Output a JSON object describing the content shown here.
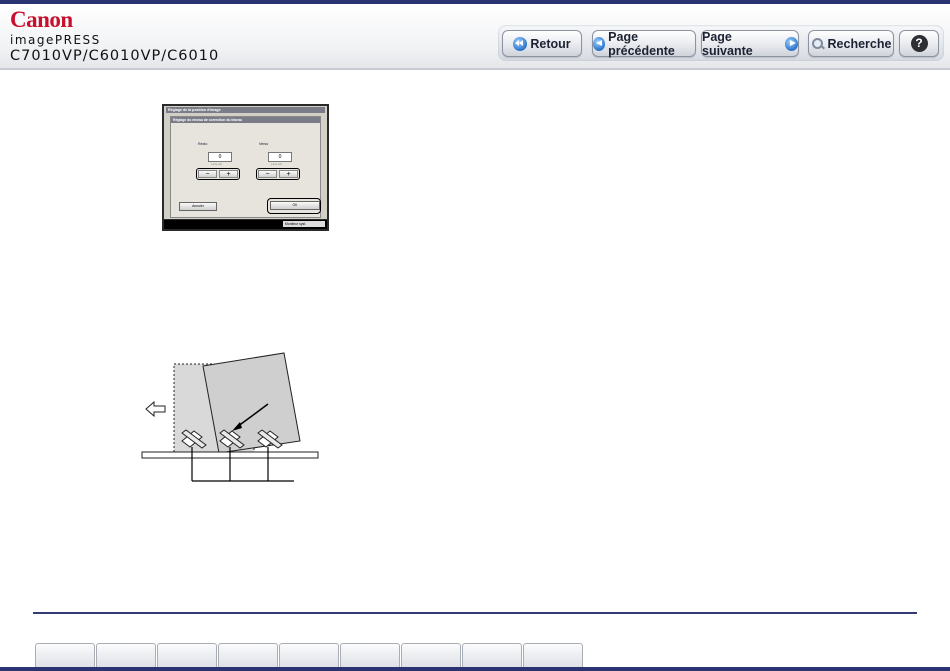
{
  "header": {
    "brand": "Canon",
    "product_line": "imagePRESS",
    "model": "C7010VP/C6010VP/C6010"
  },
  "nav": {
    "back_label": "Retour",
    "prev_label": "Page précédente",
    "next_label": "Page suivante",
    "search_label": "Recherche",
    "help_label": "?"
  },
  "screen": {
    "title": "Réglage de la position d'image",
    "subtitle": "Réglage du niveau de correction du biseau",
    "recto_label": "Recto",
    "verso_label": "Verso",
    "recto_value": "0",
    "verso_value": "0",
    "recto_unit": "(-3 à +3)",
    "verso_unit": "(-3 à +3)",
    "minus": "−",
    "plus": "+",
    "cancel_label": "Annuler",
    "ok_label": "OK",
    "status_label": "Moniteur syst."
  },
  "footer": {
    "tab_count": 9
  }
}
